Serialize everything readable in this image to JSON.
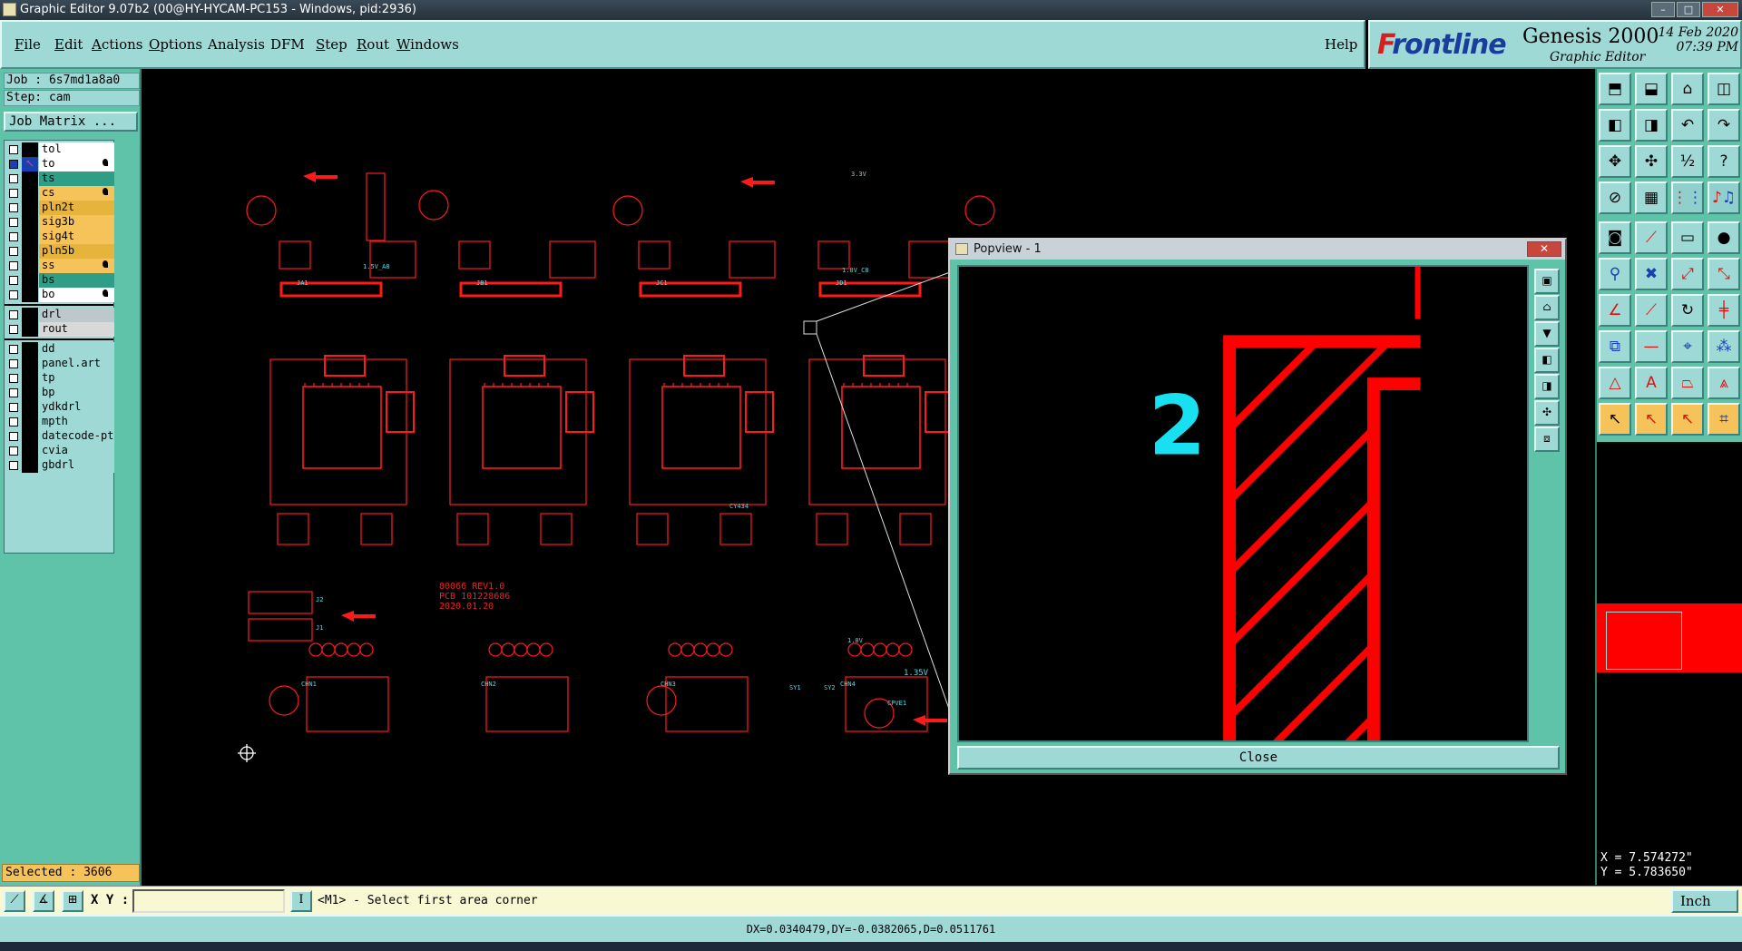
{
  "window": {
    "title": "Graphic Editor 9.07b2 (00@HY-HYCAM-PC153 - Windows, pid:2936)",
    "minimize": "–",
    "maximize": "□",
    "close": "✕"
  },
  "menu": {
    "items": [
      {
        "mnemonic": "F",
        "rest": "ile"
      },
      {
        "mnemonic": "E",
        "rest": "dit"
      },
      {
        "mnemonic": "A",
        "rest": "ctions"
      },
      {
        "mnemonic": "O",
        "rest": "ptions"
      },
      {
        "mnemonic": "",
        "rest": "Analysis"
      },
      {
        "mnemonic": "",
        "rest": "DFM"
      },
      {
        "mnemonic": "S",
        "rest": "tep"
      },
      {
        "mnemonic": "R",
        "rest": "out"
      },
      {
        "mnemonic": "W",
        "rest": "indows"
      }
    ],
    "help": "Help"
  },
  "brand": {
    "logo_first": "F",
    "logo_rest": "rontline",
    "product": "Genesis 2000",
    "subtitle": "Graphic Editor",
    "date": "14 Feb 2020",
    "time": "07:39 PM"
  },
  "job": {
    "job_label": "Job : 6s7md1a8a0",
    "step_label": "Step: cam",
    "matrix_button": "Job Matrix ..."
  },
  "layers": [
    {
      "name": "tol",
      "color": "#ffffff",
      "checked": false,
      "pointer": false,
      "flag": false
    },
    {
      "name": "to",
      "color": "#ffffff",
      "checked": true,
      "pointer": true,
      "flag": true
    },
    {
      "name": "ts",
      "color": "#2e9e86",
      "checked": false,
      "pointer": false,
      "flag": false
    },
    {
      "name": "cs",
      "color": "#f6c35a",
      "checked": false,
      "pointer": false,
      "flag": true
    },
    {
      "name": "pln2t",
      "color": "#e6b43c",
      "checked": false,
      "pointer": false,
      "flag": false
    },
    {
      "name": "sig3b",
      "color": "#f6c35a",
      "checked": false,
      "pointer": false,
      "flag": false
    },
    {
      "name": "sig4t",
      "color": "#f6c35a",
      "checked": false,
      "pointer": false,
      "flag": false
    },
    {
      "name": "pln5b",
      "color": "#e6b43c",
      "checked": false,
      "pointer": false,
      "flag": false
    },
    {
      "name": "ss",
      "color": "#f6c35a",
      "checked": false,
      "pointer": false,
      "flag": true
    },
    {
      "name": "bs",
      "color": "#2e9e86",
      "checked": false,
      "pointer": false,
      "flag": false
    },
    {
      "name": "bo",
      "color": "#ffffff",
      "checked": false,
      "pointer": false,
      "flag": true
    }
  ],
  "drill_layers": [
    {
      "name": "drl",
      "color": "#bcc8cc"
    },
    {
      "name": "rout",
      "color": "#d9d9d9"
    }
  ],
  "misc_layers": [
    {
      "name": "dd"
    },
    {
      "name": "panel.art"
    },
    {
      "name": "tp"
    },
    {
      "name": "bp"
    },
    {
      "name": "ydkdrl"
    },
    {
      "name": "mpth"
    },
    {
      "name": "datecode-pt"
    },
    {
      "name": "cvia"
    },
    {
      "name": "gbdrl"
    }
  ],
  "selected": "Selected : 3606",
  "board": {
    "code": "80066 REV1.0",
    "pcb": "PCB 101228686",
    "date": "2020.01.20",
    "ref_15v": "1.5V_A8",
    "ref_18v": "1.8V_C8",
    "ref_135v": "1.35V",
    "ref_33v": "3.3V",
    "ref_1v": "1.0V",
    "j1": "JA1",
    "j2": "JB1",
    "j3": "JC1",
    "j4": "JD1",
    "cy": "CY434",
    "ch1": "CHN1",
    "ch2": "CHN2",
    "ch3": "CHN3",
    "ch4": "CHN4",
    "sy1": "SY1",
    "sy2": "SY2",
    "cpve": "CPVE1",
    "j_2": "J2",
    "j_1": "J1"
  },
  "popview": {
    "title": "Popview - 1",
    "zoom_text": "2",
    "close_button": "Close",
    "window_close": "✕"
  },
  "coords": {
    "x": "X = 7.574272\"",
    "y": "Y = 5.783650\""
  },
  "command": {
    "xy_label": "X Y :",
    "xy_value": "",
    "mode_icon": "I",
    "prompt": "<M1> - Select first area corner",
    "unit": "Inch"
  },
  "status": {
    "measure": "DX=0.0340479,DY=-0.0382065,D=0.0511761"
  },
  "icons": {
    "toolbox": [
      "open-step-icon",
      "save-icon",
      "home-icon",
      "split-view-icon",
      "prev-step-icon",
      "next-step-icon",
      "zoom-back-icon",
      "zoom-forward-icon",
      "zoom-fit-icon",
      "zoom-page-icon",
      "scale-one-to-two-icon",
      "help-icon",
      "measure-icon",
      "grid-icon",
      "snap-icon",
      "layers-icon",
      "camera-icon",
      "flip-icon",
      "ruler-icon",
      "pad-icon",
      "add-feature-icon",
      "delete-feature-icon",
      "move-feature-icon",
      "copy-feature-icon",
      "line-icon",
      "polyline-icon",
      "arc-icon",
      "surface-icon",
      "resize-icon",
      "cut-icon",
      "netlist-icon",
      "nodes-icon",
      "triangle-icon",
      "triangle-a-icon",
      "trapezoid-icon",
      "region-icon",
      "select-pointer-icon",
      "select-area-icon",
      "select-poly-icon",
      "select-net-icon"
    ]
  }
}
